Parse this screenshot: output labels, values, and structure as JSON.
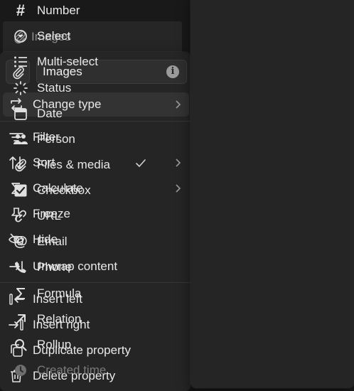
{
  "background_field": {
    "label": "Images"
  },
  "property": {
    "name_value": "Images",
    "info_symbol": "i"
  },
  "left_menu": {
    "items": [
      {
        "label": "Change type",
        "icon": "change-type-icon"
      },
      {
        "label": "Filter",
        "icon": "filter-icon"
      },
      {
        "label": "Sort",
        "icon": "sort-icon"
      },
      {
        "label": "Calculate",
        "icon": "sigma-icon"
      },
      {
        "label": "Freeze",
        "icon": "pin-icon"
      },
      {
        "label": "Hide",
        "icon": "eye-off-icon"
      },
      {
        "label": "Unwrap content",
        "icon": "unwrap-icon"
      },
      {
        "label": "Insert left",
        "icon": "insert-left-icon"
      },
      {
        "label": "Insert right",
        "icon": "insert-right-icon"
      },
      {
        "label": "Duplicate property",
        "icon": "duplicate-icon"
      },
      {
        "label": "Delete property",
        "icon": "trash-icon"
      }
    ]
  },
  "type_menu": {
    "items": [
      {
        "label": "Number",
        "icon": "hash-icon"
      },
      {
        "label": "Select",
        "icon": "select-icon"
      },
      {
        "label": "Multi-select",
        "icon": "list-icon"
      },
      {
        "label": "Status",
        "icon": "status-icon"
      },
      {
        "label": "Date",
        "icon": "calendar-icon"
      },
      {
        "label": "Person",
        "icon": "people-icon"
      },
      {
        "label": "Files & media",
        "icon": "paperclip-icon",
        "selected": true
      },
      {
        "label": "Checkbox",
        "icon": "checkbox-icon"
      },
      {
        "label": "URL",
        "icon": "link-icon"
      },
      {
        "label": "Email",
        "icon": "at-icon"
      },
      {
        "label": "Phone",
        "icon": "phone-icon"
      },
      {
        "label": "Formula",
        "icon": "sigma-icon"
      },
      {
        "label": "Relation",
        "icon": "arrow-up-right-icon"
      },
      {
        "label": "Rollup",
        "icon": "magnifier-icon"
      },
      {
        "label": "Created time",
        "icon": "clock-icon"
      }
    ]
  }
}
